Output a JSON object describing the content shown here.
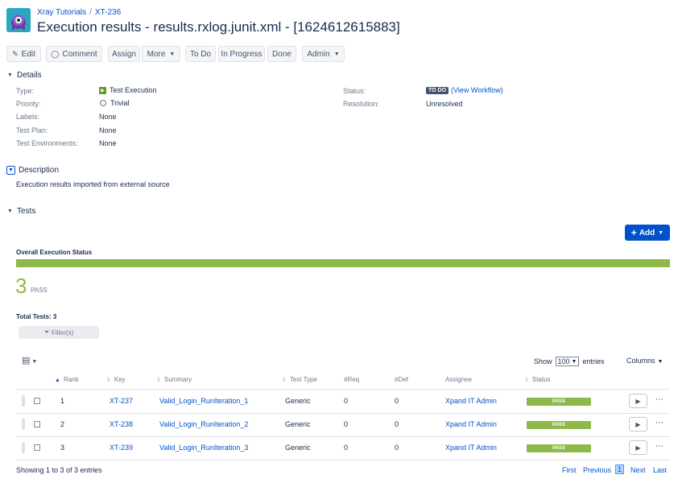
{
  "breadcrumb": {
    "project": "Xray Tutorials",
    "issue": "XT-236"
  },
  "page_title": "Execution results - results.rxlog.junit.xml - [1624612615883]",
  "toolbar": {
    "edit": "Edit",
    "comment": "Comment",
    "assign": "Assign",
    "more": "More",
    "to_do": "To Do",
    "in_progress": "In Progress",
    "done": "Done",
    "admin": "Admin"
  },
  "details": {
    "header": "Details",
    "type_label": "Type:",
    "type_value": "Test Execution",
    "priority_label": "Priority:",
    "priority_value": "Trivial",
    "labels_label": "Labels:",
    "labels_value": "None",
    "test_plan_label": "Test Plan:",
    "test_plan_value": "None",
    "test_env_label": "Test Environments:",
    "test_env_value": "None",
    "status_label": "Status:",
    "status_value": "TO DO",
    "view_workflow": "(View Workflow)",
    "resolution_label": "Resolution:",
    "resolution_value": "Unresolved"
  },
  "description": {
    "header": "Description",
    "text": "Execution results imported from external source"
  },
  "tests": {
    "header": "Tests",
    "add_button": "Add",
    "overall_label": "Overall Execution Status",
    "pass_count": "3",
    "pass_label": "PASS",
    "pass_fraction": 1.0,
    "total_tests": "Total Tests: 3",
    "filter_button": "Filter(s)",
    "show_label": "Show",
    "show_value": "100",
    "entries_label": "entries",
    "columns_label": "Columns",
    "headers": {
      "rank": "Rank",
      "key": "Key",
      "summary": "Summary",
      "test_type": "Test Type",
      "req": "#Req",
      "def": "#Def",
      "assignee": "Assignee",
      "status": "Status"
    },
    "rows": [
      {
        "rank": "1",
        "key": "XT-237",
        "summary": "Valid_Login_RunIteration_1",
        "test_type": "Generic",
        "req": "0",
        "def": "0",
        "assignee": "Xpand IT Admin",
        "status": "PASS"
      },
      {
        "rank": "2",
        "key": "XT-238",
        "summary": "Valid_Login_RunIteration_2",
        "test_type": "Generic",
        "req": "0",
        "def": "0",
        "assignee": "Xpand IT Admin",
        "status": "PASS"
      },
      {
        "rank": "3",
        "key": "XT-239",
        "summary": "Valid_Login_RunIteration_3",
        "test_type": "Generic",
        "req": "0",
        "def": "0",
        "assignee": "Xpand IT Admin",
        "status": "PASS"
      }
    ],
    "showing": "Showing 1 to 3 of 3 entries",
    "pager": {
      "first": "First",
      "previous": "Previous",
      "current": "1",
      "next": "Next",
      "last": "Last"
    }
  },
  "colors": {
    "pass_green": "#8eb84a",
    "link_blue": "#0052cc",
    "primary_button": "#0052cc"
  }
}
